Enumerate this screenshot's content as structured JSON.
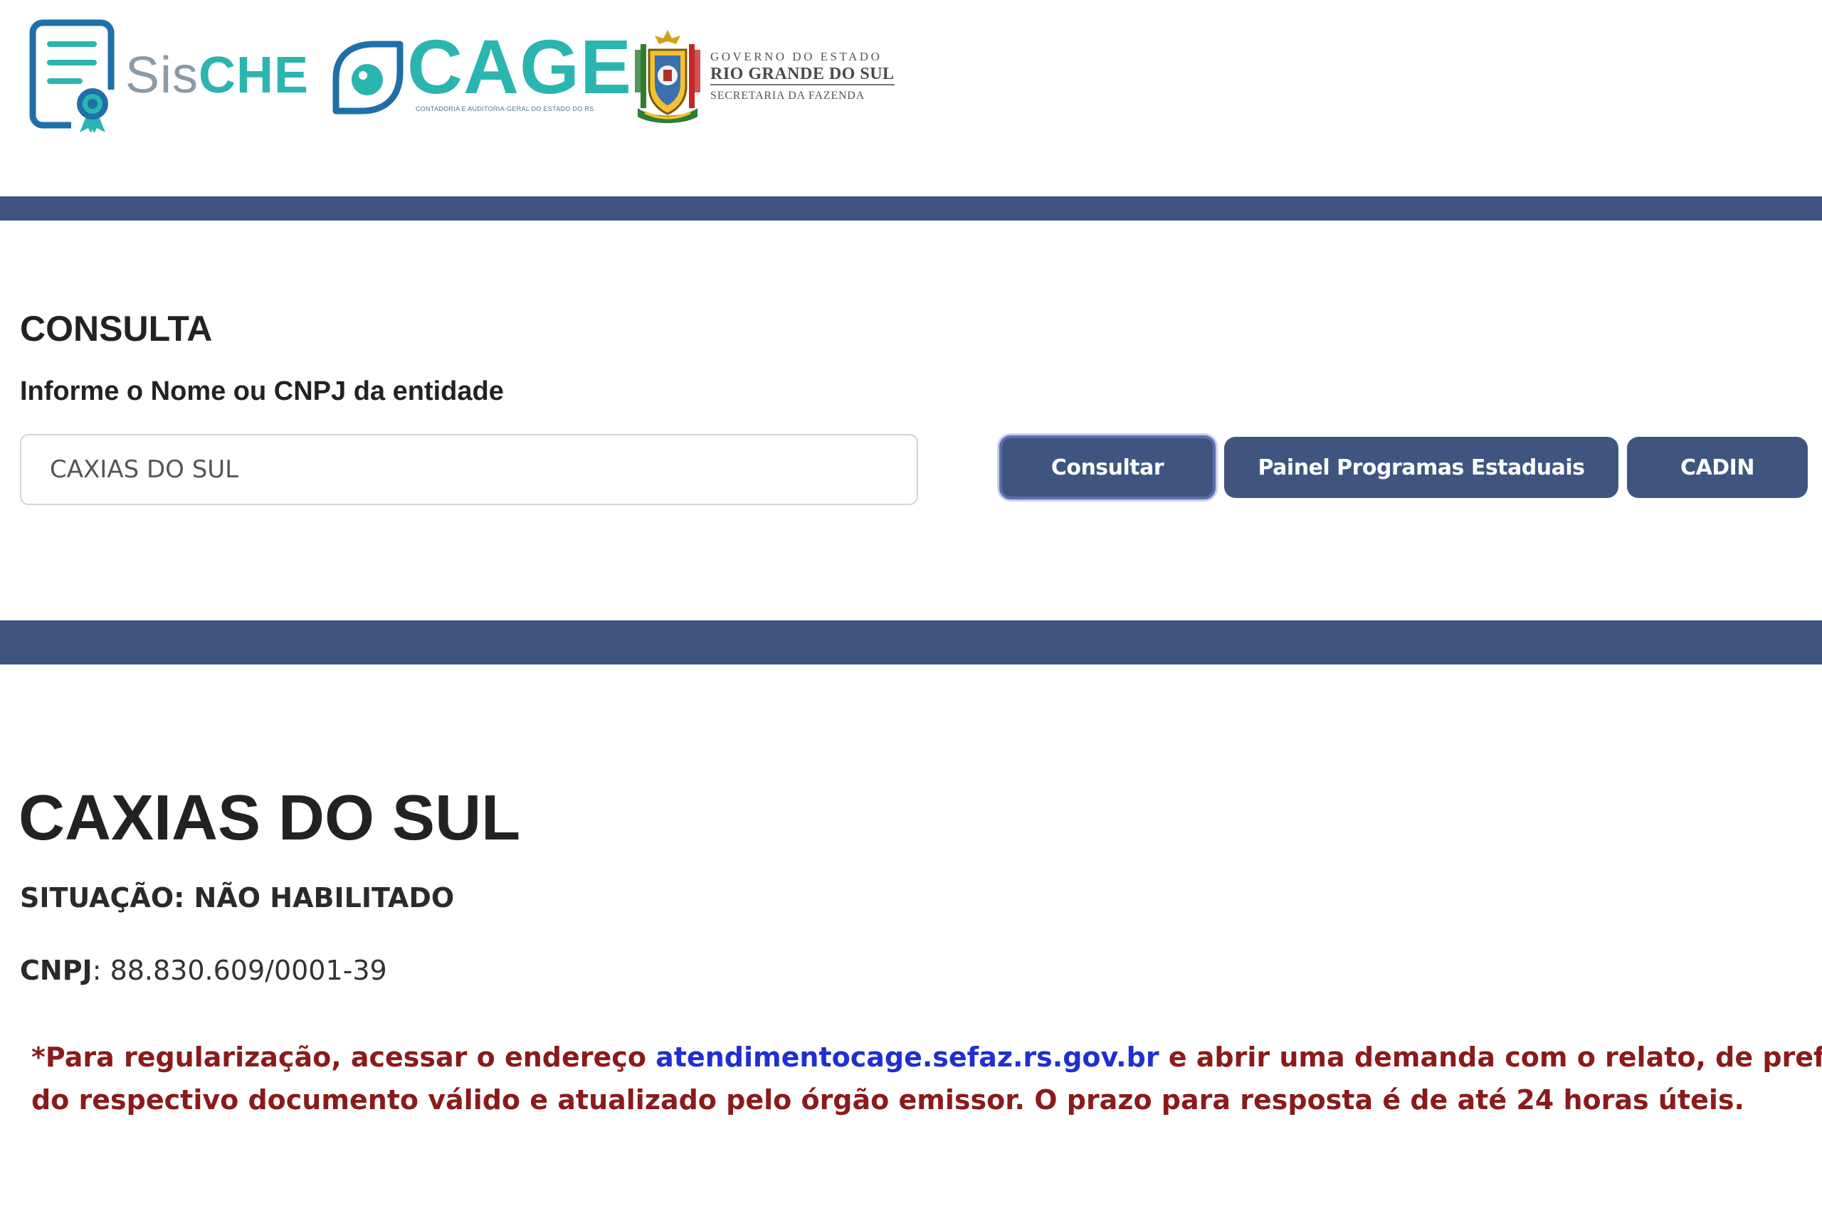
{
  "header": {
    "sische_logo": {
      "part1": "Sis",
      "part2": "CHE"
    },
    "cage_logo": {
      "text": "CAGE",
      "subtitle": "CONTADORIA E AUDITORIA-GERAL DO ESTADO DO RS"
    },
    "gov_logo": {
      "line1": "GOVERNO DO ESTADO",
      "line2": "RIO GRANDE DO SUL",
      "line3": "SECRETARIA DA FAZENDA"
    }
  },
  "consulta": {
    "title": "CONSULTA",
    "label": "Informe o Nome ou CNPJ da entidade",
    "search_value": "CAXIAS DO SUL",
    "buttons": {
      "consultar": "Consultar",
      "painel": "Painel Programas Estaduais",
      "cadin": "CADIN"
    }
  },
  "result": {
    "title": "CAXIAS DO SUL",
    "status": "SITUAÇÃO: NÃO HABILITADO",
    "cnpj_label": "CNPJ",
    "cnpj_value": ": 88.830.609/0001-39",
    "note_part1": "*Para regularização, acessar o endereço ",
    "note_link": "atendimentocage.sefaz.rs.gov.br",
    "note_part2": " e abrir uma demanda com o relato, de preferência co",
    "note_line2": "do respectivo documento válido e atualizado pelo órgão emissor. O prazo para resposta é de até 24 horas úteis."
  },
  "colors": {
    "brand_band": "#3f5580",
    "teal_accent": "#2bb5b0",
    "warning_text": "#8b1a1a",
    "link": "#1f2fd0"
  },
  "icons": {
    "sische": "certificate-document-icon",
    "cage": "eye-leaf-icon",
    "gov": "rio-grande-do-sul-coat-of-arms-icon"
  }
}
